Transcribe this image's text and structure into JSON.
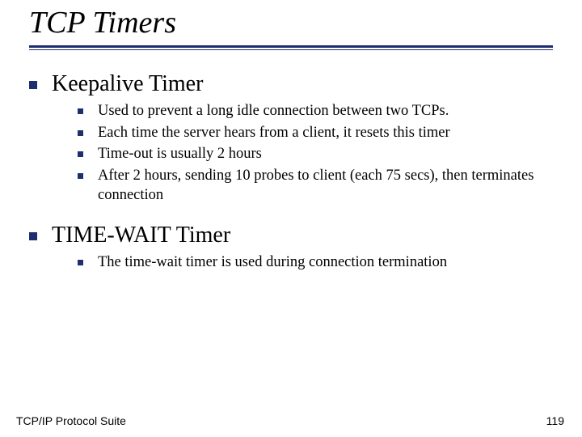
{
  "title": "TCP Timers",
  "sections": [
    {
      "heading": "Keepalive Timer",
      "items": [
        "Used to prevent a long idle connection between two TCPs.",
        "Each time the server hears from a client, it resets this timer",
        "Time-out is usually 2 hours",
        "After 2 hours, sending 10 probes to client (each 75 secs), then terminates connection"
      ]
    },
    {
      "heading": "TIME-WAIT Timer",
      "items": [
        "The time-wait timer is used during connection termination"
      ]
    }
  ],
  "footer": "TCP/IP Protocol Suite",
  "page": "119",
  "colors": {
    "accent": "#1d2f6f"
  }
}
